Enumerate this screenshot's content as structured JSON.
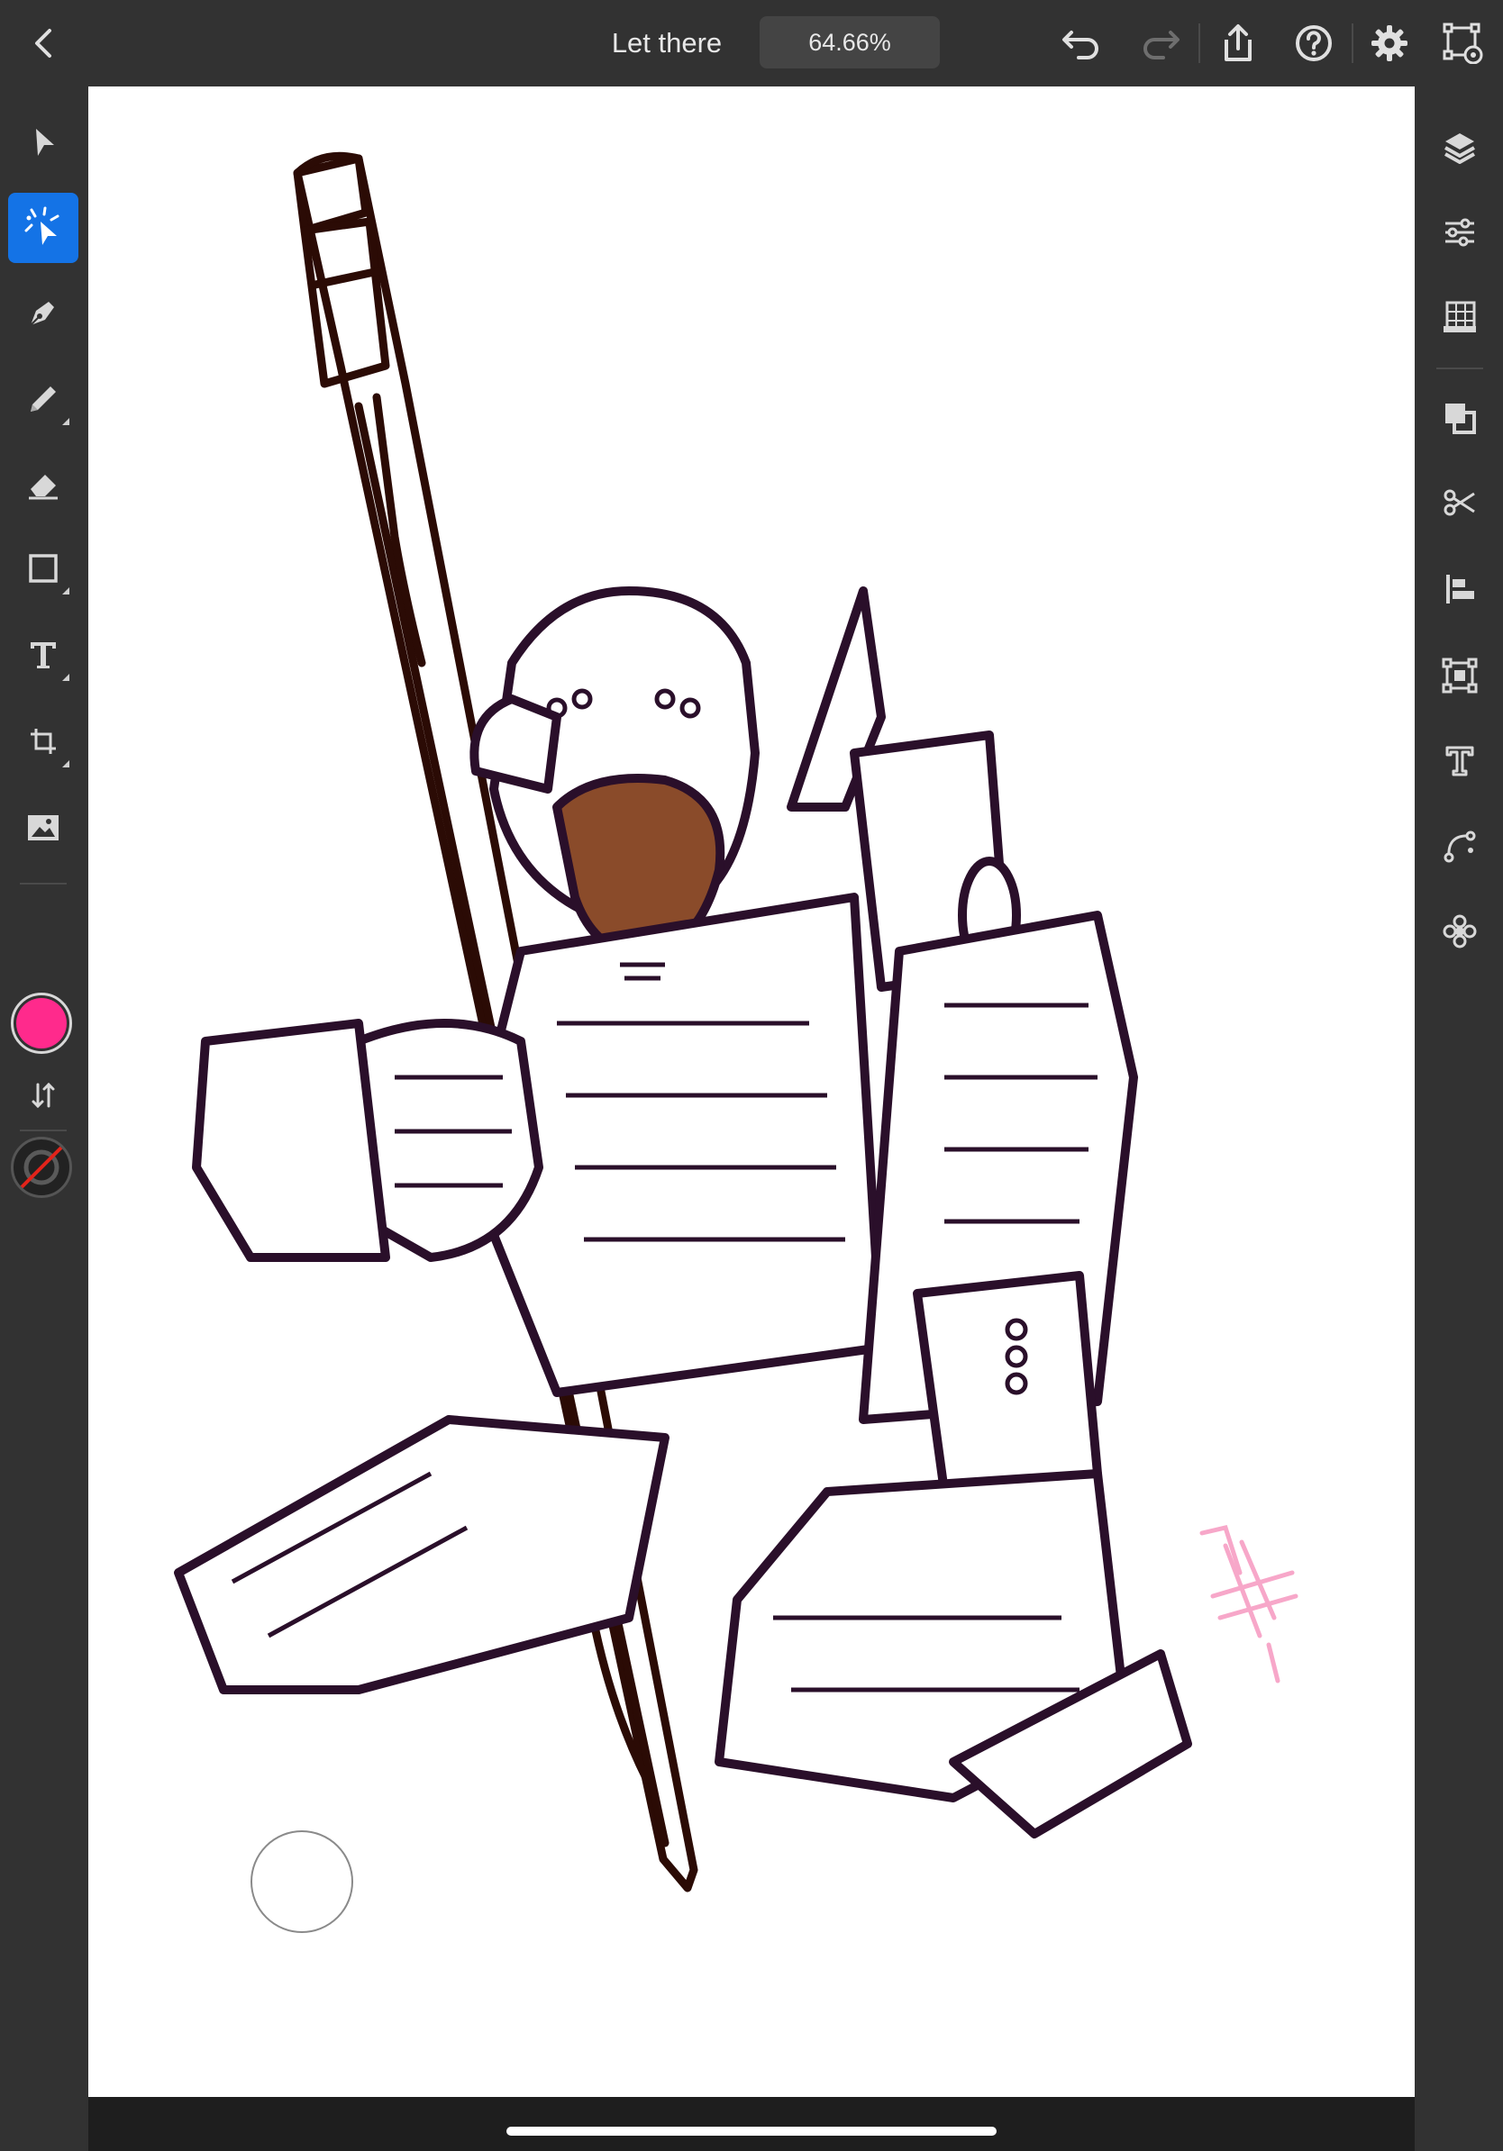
{
  "app": {
    "document_title": "Let there",
    "zoom_level": "64.66%"
  },
  "top_bar": {
    "icons": [
      "back-chevron-icon",
      "undo-icon",
      "redo-icon",
      "share-icon",
      "help-icon",
      "settings-gear-icon",
      "artboard-preview-icon"
    ]
  },
  "left_toolbar": {
    "tools": [
      {
        "name": "selection-tool",
        "icon": "arrow-pointer-icon",
        "active": false
      },
      {
        "name": "direct-selection-tool",
        "icon": "direct-select-sparkle-icon",
        "active": true
      },
      {
        "name": "pen-tool",
        "icon": "pen-nib-icon",
        "active": false
      },
      {
        "name": "pencil-tool",
        "icon": "pencil-icon",
        "active": false
      },
      {
        "name": "eraser-tool",
        "icon": "eraser-icon",
        "active": false
      },
      {
        "name": "rectangle-tool",
        "icon": "rectangle-icon",
        "active": false
      },
      {
        "name": "type-tool",
        "icon": "text-T-icon",
        "active": false
      },
      {
        "name": "transform-tool",
        "icon": "transform-crop-icon",
        "active": false
      },
      {
        "name": "image-tool",
        "icon": "image-icon",
        "active": false
      }
    ],
    "fill_color": "#ff2a8c",
    "stroke_color": "none"
  },
  "right_panel": {
    "icons": [
      "layers-icon",
      "properties-sliders-icon",
      "grid-guides-icon",
      "combine-shapes-icon",
      "scissors-icon",
      "align-left-icon",
      "transform-box-icon",
      "type-properties-icon",
      "path-curve-icon",
      "repeat-pattern-icon"
    ]
  },
  "colors": {
    "chrome_bg": "#323232",
    "active_tool": "#1473e6",
    "canvas_bg": "#ffffff",
    "line_art": "#2a0f2a",
    "pencil_outline": "#2b0b05",
    "signature": "#f7a7c9"
  }
}
